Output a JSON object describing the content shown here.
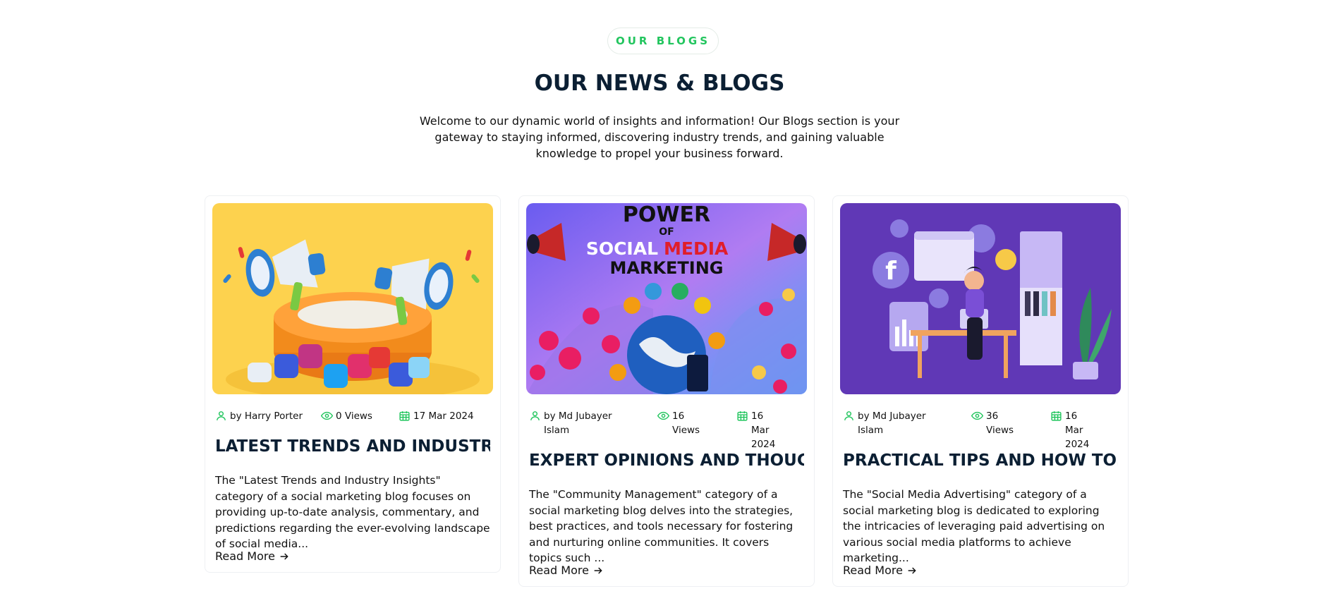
{
  "section": {
    "eyebrow": "OUR BLOGS",
    "title": "OUR NEWS & BLOGS",
    "intro": "Welcome to our dynamic world of insights and information! Our Blogs section is your gateway to staying informed, discovering industry trends, and gaining valuable knowledge to propel your business forward."
  },
  "colors": {
    "accent": "#22c55e",
    "heading": "#0b1f33"
  },
  "posts": [
    {
      "image": "megaphones-social-icons-yellow",
      "author": "by Harry Porter",
      "views": "0 Views",
      "date": "17 Mar 2024",
      "title": "LATEST TRENDS AND INDUSTRY...",
      "excerpt": "The \"Latest Trends and Industry Insights\" category of a social marketing blog focuses on providing up-to-date analysis, commentary, and predictions regarding the ever-evolving landscape of social media...",
      "read_more": "Read More"
    },
    {
      "image": "power-of-social-media-marketing",
      "image_text": [
        "POWER",
        "OF",
        "SOCIAL",
        "MEDIA",
        "MARKETING"
      ],
      "author": "by Md Jubayer Islam",
      "views": "16 Views",
      "date": "16 Mar 2024",
      "title": "EXPERT OPINIONS AND THOUGHT...",
      "excerpt": "The \"Community Management\" category of a social marketing blog delves into the strategies, best practices, and tools necessary for fostering and nurturing online communities. It covers topics such ...",
      "read_more": "Read More"
    },
    {
      "image": "woman-at-desk-social-icons-purple",
      "author": "by Md Jubayer Islam",
      "views": "36 Views",
      "date": "16 Mar 2024",
      "title": "PRACTICAL TIPS AND HOW TO...",
      "excerpt": "The \"Social Media Advertising\" category of a social marketing blog is dedicated to exploring the intricacies of leveraging paid advertising on various social media platforms to achieve marketing...",
      "read_more": "Read More"
    }
  ]
}
